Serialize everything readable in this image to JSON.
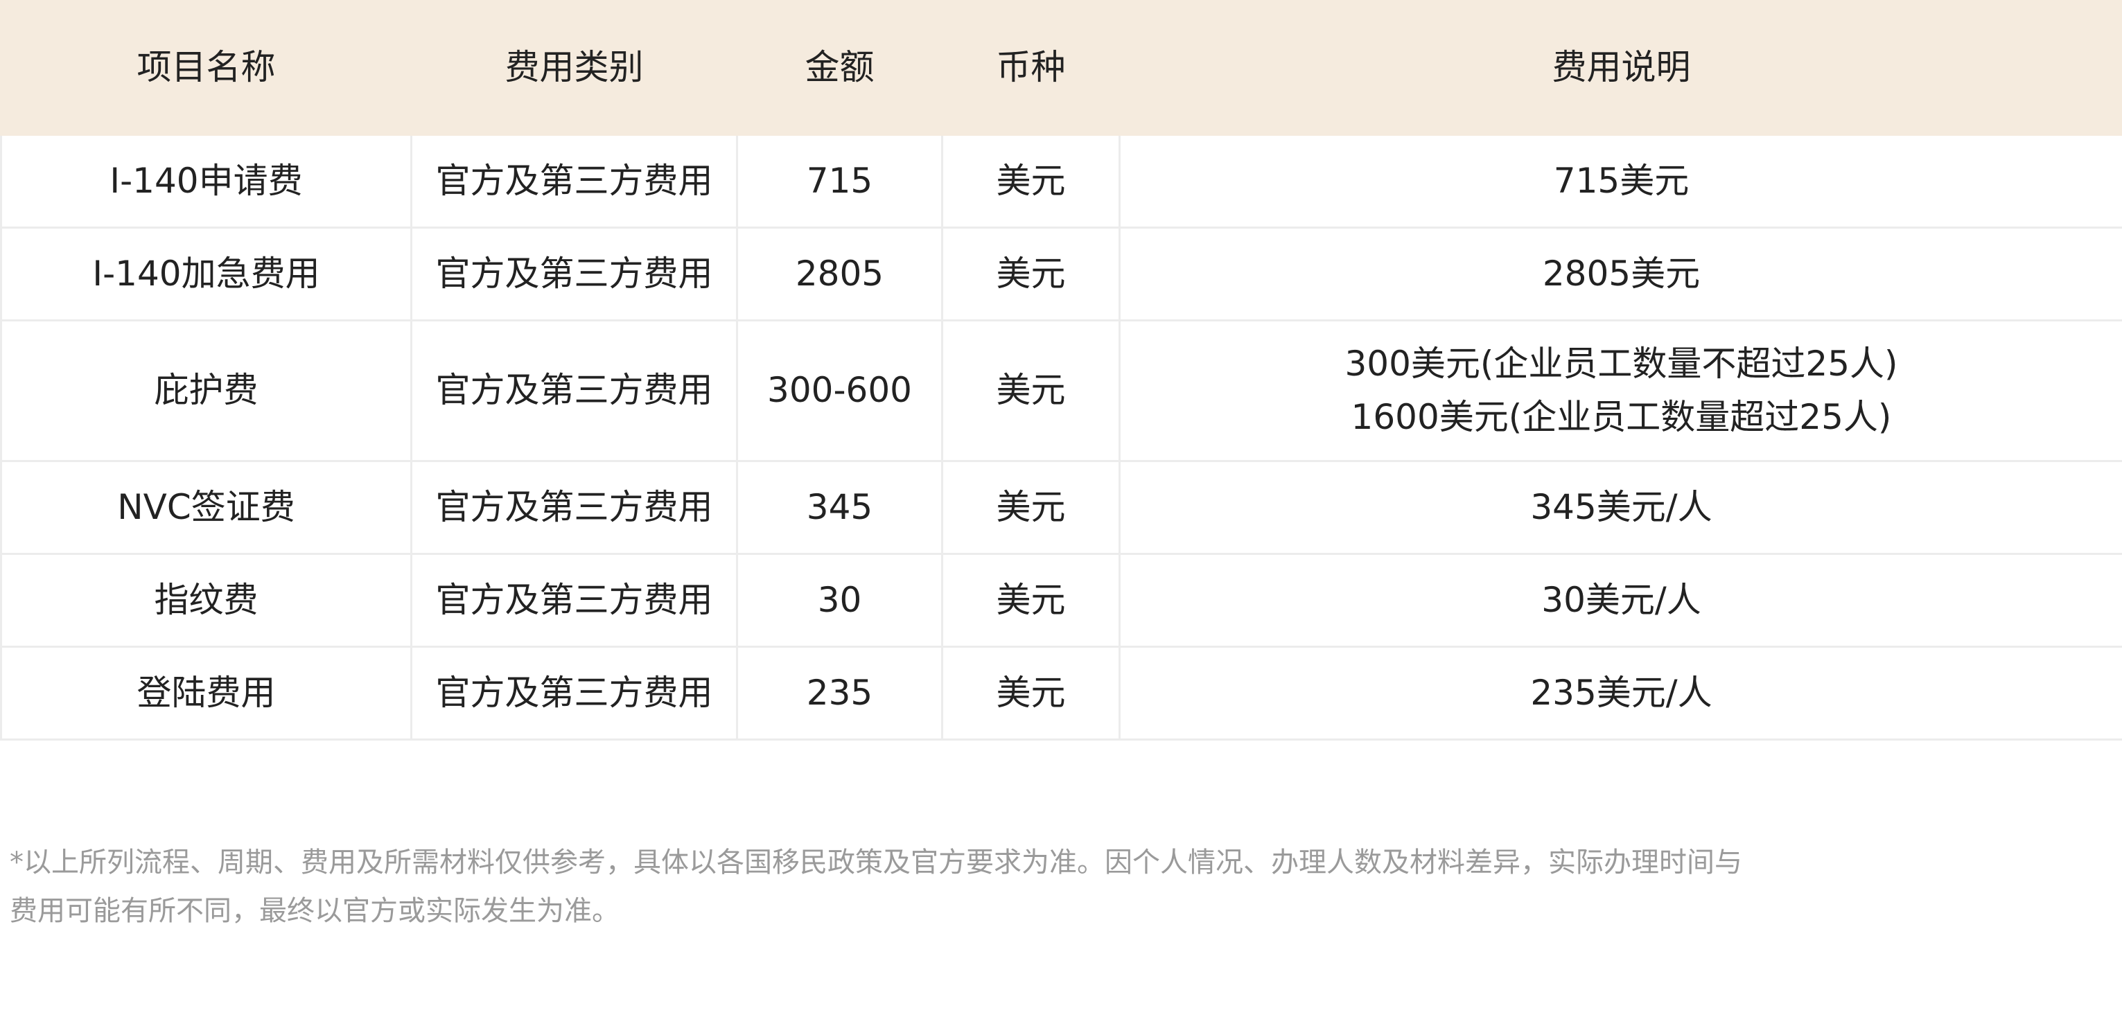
{
  "table": {
    "headers": [
      "项目名称",
      "费用类别",
      "金额",
      "币种",
      "费用说明"
    ],
    "rows": [
      {
        "name": "I-140申请费",
        "category": "官方及第三方费用",
        "amount": "715",
        "currency": "美元",
        "desc": [
          "715美元"
        ]
      },
      {
        "name": "I-140加急费用",
        "category": "官方及第三方费用",
        "amount": "2805",
        "currency": "美元",
        "desc": [
          "2805美元"
        ]
      },
      {
        "name": "庇护费",
        "category": "官方及第三方费用",
        "amount": "300-600",
        "currency": "美元",
        "desc": [
          "300美元(企业员工数量不超过25人)",
          "1600美元(企业员工数量超过25人)"
        ]
      },
      {
        "name": "NVC签证费",
        "category": "官方及第三方费用",
        "amount": "345",
        "currency": "美元",
        "desc": [
          "345美元/人"
        ]
      },
      {
        "name": "指纹费",
        "category": "官方及第三方费用",
        "amount": "30",
        "currency": "美元",
        "desc": [
          "30美元/人"
        ]
      },
      {
        "name": "登陆费用",
        "category": "官方及第三方费用",
        "amount": "235",
        "currency": "美元",
        "desc": [
          "235美元/人"
        ]
      }
    ]
  },
  "footnote": {
    "line1": "*以上所列流程、周期、费用及所需材料仅供参考，具体以各国移民政策及官方要求为准。因个人情况、办理人数及材料差异，实际办理时间与",
    "line2": "费用可能有所不同，最终以官方或实际发生为准。"
  },
  "colors": {
    "header_bg": "#f5ebde",
    "grid": "#ececec",
    "text": "#222222",
    "footnote": "#9a9a9a"
  }
}
